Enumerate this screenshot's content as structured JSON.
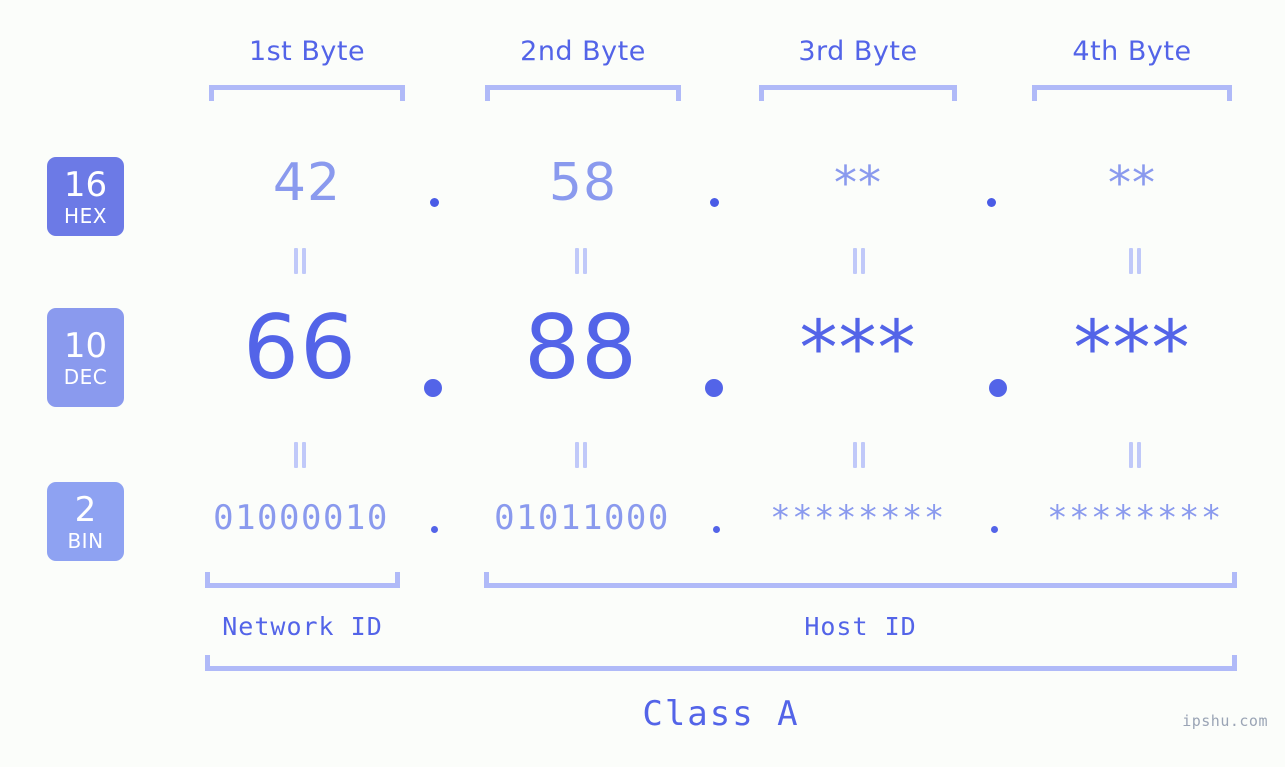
{
  "background_color": "#fbfdfa",
  "accent_color": "#5364e8",
  "muted_accent_color": "#8a9aee",
  "bracket_color": "#b0baf8",
  "byte_headers": [
    {
      "label": "1st Byte"
    },
    {
      "label": "2nd Byte"
    },
    {
      "label": "3rd Byte"
    },
    {
      "label": "4th Byte"
    }
  ],
  "bases": [
    {
      "number": "16",
      "name": "HEX",
      "color": "#6c7ae6"
    },
    {
      "number": "10",
      "name": "DEC",
      "color": "#8a9aee"
    },
    {
      "number": "2",
      "name": "BIN",
      "color": "#8ea2f2"
    }
  ],
  "rows": {
    "hex": {
      "values": [
        "42",
        "58",
        "**",
        "**"
      ],
      "separators": [
        ".",
        ".",
        "."
      ]
    },
    "dec": {
      "values": [
        "66",
        "88",
        "***",
        "***"
      ],
      "separators": [
        ".",
        ".",
        "."
      ]
    },
    "bin": {
      "values": [
        "01000010",
        "01011000",
        "********",
        "********"
      ],
      "separators": [
        ".",
        ".",
        "."
      ]
    }
  },
  "equality_marks": [
    "=",
    "=",
    "=",
    "=",
    "=",
    "=",
    "=",
    "="
  ],
  "id_labels": [
    {
      "label": "Network ID"
    },
    {
      "label": "Host ID"
    }
  ],
  "class_label": "Class A",
  "watermark": "ipshu.com"
}
